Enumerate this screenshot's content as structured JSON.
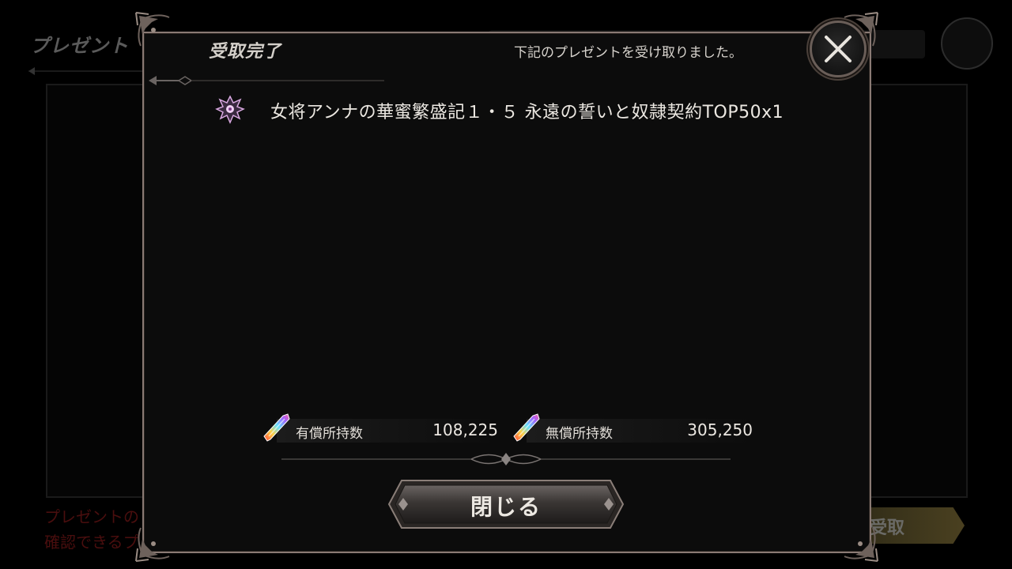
{
  "background": {
    "screen_title": "プレゼント",
    "note_line1": "プレゼントの",
    "note_line2": "確認できるプ",
    "receive_button_label": "受取"
  },
  "modal": {
    "title": "受取完了",
    "subtitle": "下記のプレゼントを受け取りました。",
    "close_icon": "close-x-icon",
    "items": [
      {
        "icon": "crest-icon",
        "label": "女将アンナの華蜜繁盛記１・５ 永遠の誓いと奴隷契約TOP50x1"
      }
    ],
    "currency": {
      "paid_label": "有償所持数",
      "paid_value": "108,225",
      "free_label": "無償所持数",
      "free_value": "305,250"
    },
    "close_button_label": "閉じる"
  },
  "colors": {
    "frame": "#8a7a74",
    "modal_bg": "#0c0c0c",
    "text": "#ece8e2",
    "background_note": "#4a0e0e"
  }
}
